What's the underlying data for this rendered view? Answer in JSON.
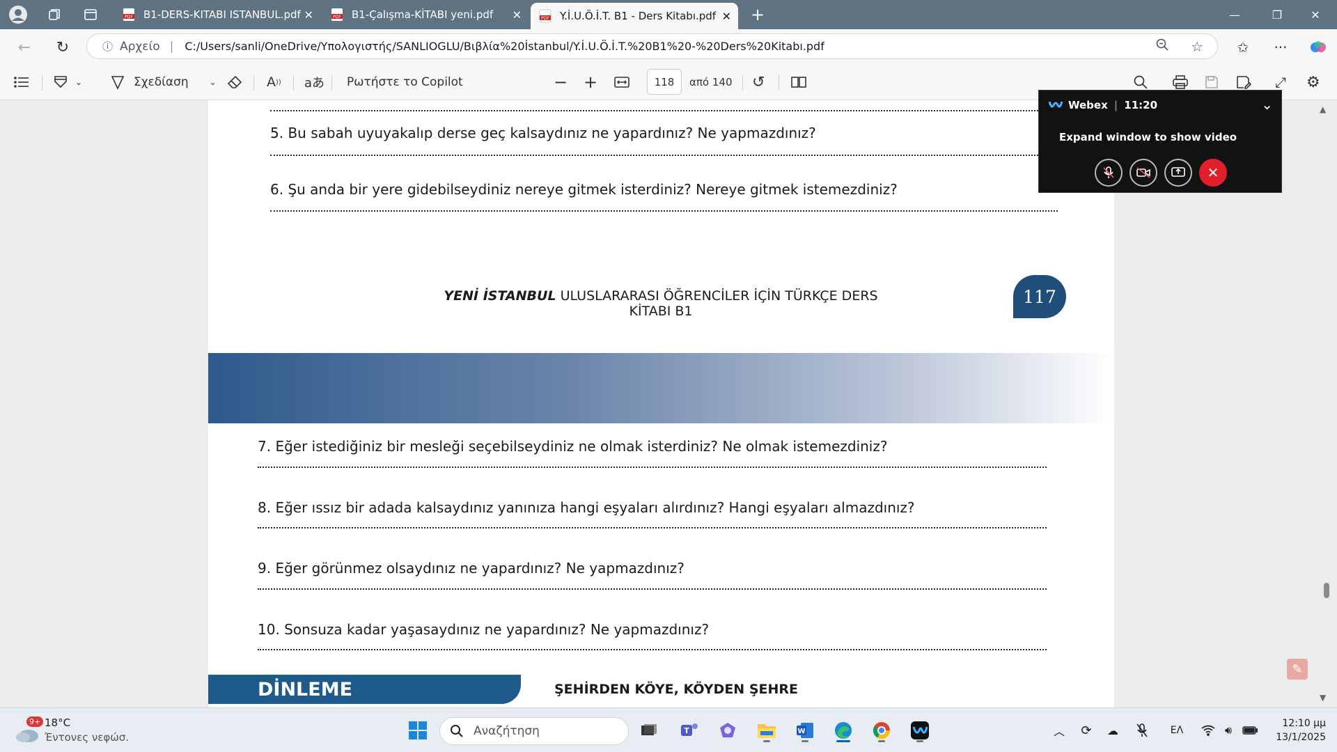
{
  "browser": {
    "tabs": [
      {
        "title": "B1-DERS-KITABI ISTANBUL.pdf",
        "active": false
      },
      {
        "title": "B1-Çalışma-KİTABI yeni.pdf",
        "active": false
      },
      {
        "title": "Y.İ.U.Ö.İ.T. B1 - Ders Kitabı.pdf",
        "active": true
      }
    ],
    "address": {
      "source_label": "Αρχείο",
      "url": "C:/Users/sanli/OneDrive/Υπολογιστής/SANLIOGLU/Βιβλία%20İstanbul/Y.İ.U.Ö.İ.T.%20B1%20-%20Ders%20Kitabı.pdf"
    }
  },
  "pdf_toolbar": {
    "draw_label": "Σχεδίαση",
    "copilot_label": "Ρωτήστε το Copilot",
    "page_current": "118",
    "page_total_label": "από 140"
  },
  "document": {
    "page_117": {
      "questions": [
        "5. Bu sabah uyuyakalıp derse geç kalsaydınız ne yapardınız? Ne yapmazdınız?",
        "6. Şu anda bir yere gidebilseydiniz nereye gitmek isterdiniz? Nereye gitmek istemezdiniz?"
      ],
      "footer_bold": "YENİ İSTANBUL",
      "footer_rest": " ULUSLARARASI ÖĞRENCİLER İÇİN TÜRKÇE DERS KİTABI B1",
      "page_number": "117"
    },
    "page_118": {
      "questions": [
        "7. Eğer istediğiniz bir mesleği seçebilseydiniz ne olmak isterdiniz? Ne olmak istemezdiniz?",
        "8. Eğer ıssız bir adada kalsaydınız yanınıza hangi eşyaları alırdınız? Hangi eşyaları almazdınız?",
        "9. Eğer görünmez olsaydınız ne yapardınız? Ne yapmazdınız?",
        "10. Sonsuza kadar yaşasaydınız ne yapardınız? Ne yapmazdınız?"
      ],
      "section_label": "DİNLEME",
      "section_title": "ŞEHİRDEN KÖYE, KÖYDEN ŞEHRE"
    }
  },
  "webex": {
    "app": "Webex",
    "time": "11:20",
    "message": "Expand window to show video"
  },
  "taskbar": {
    "weather_badge": "9+",
    "temperature": "18°C",
    "weather_desc": "Έντονες νεφώσ.",
    "search_placeholder": "Αναζήτηση",
    "language": "ΕΛ",
    "time": "12:10 μμ",
    "date": "13/1/2025"
  },
  "colors": {
    "tabstrip": "#5f7382",
    "page_badge": "#1f4e7a",
    "dinleme_bar": "#1f5a8d",
    "webex_end": "#e0202c"
  }
}
